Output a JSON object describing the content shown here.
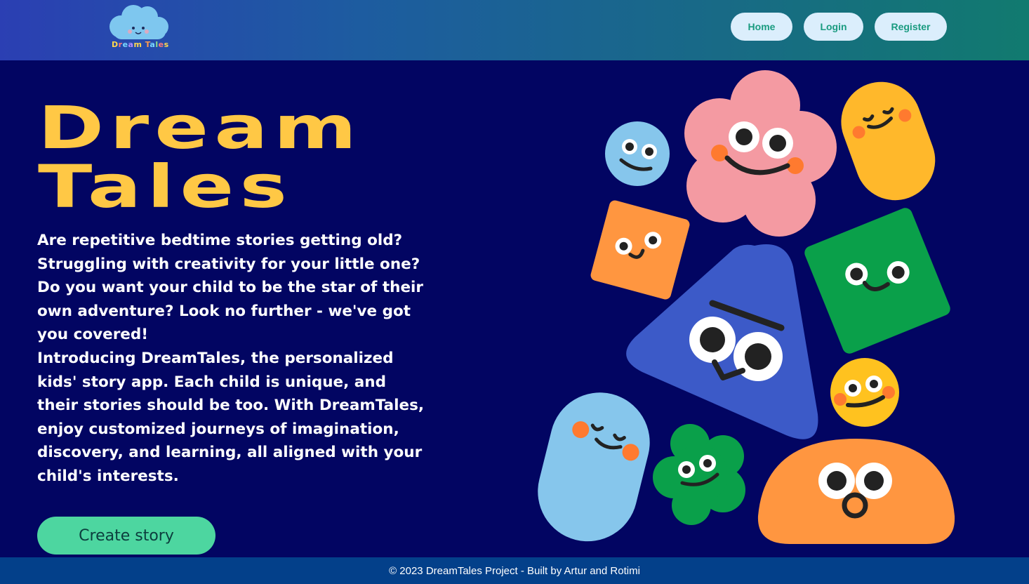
{
  "header": {
    "logo_text": [
      "D",
      "r",
      "e",
      "a",
      "m",
      " ",
      "T",
      "a",
      "l",
      "e",
      "s"
    ],
    "nav": [
      {
        "label": "Home"
      },
      {
        "label": "Login"
      },
      {
        "label": "Register"
      }
    ]
  },
  "hero": {
    "title_line1": "Dream",
    "title_line2": "Tales",
    "paragraph1": "Are repetitive bedtime stories getting old? Struggling with creativity for your little one? Do you want your child to be the star of their own adventure? Look no further - we've got you covered!",
    "paragraph2": "Introducing DreamTales, the personalized kids' story app. Each child is unique, and their stories should be too. With DreamTales, enjoy customized journeys of imagination, discovery, and learning, all aligned with your child's interests.",
    "cta_label": "Create story"
  },
  "footer": {
    "text": "© 2023 DreamTales Project - Built by Artur and Rotimi"
  },
  "colors": {
    "background": "#020562",
    "title": "#ffc845",
    "cta": "#4dd6a0",
    "nav_button": "#dbeefc",
    "nav_text": "#1a9b80",
    "footer": "#03408a"
  },
  "illustration": {
    "characters": [
      "cloud-mascot-icon",
      "blue-circle-face",
      "pink-flower-face",
      "yellow-pill-face",
      "orange-square-face",
      "blue-triangle-face",
      "green-square-face",
      "yellow-circle-face",
      "light-blue-pill-face",
      "green-flower-face",
      "orange-dome-face"
    ]
  }
}
